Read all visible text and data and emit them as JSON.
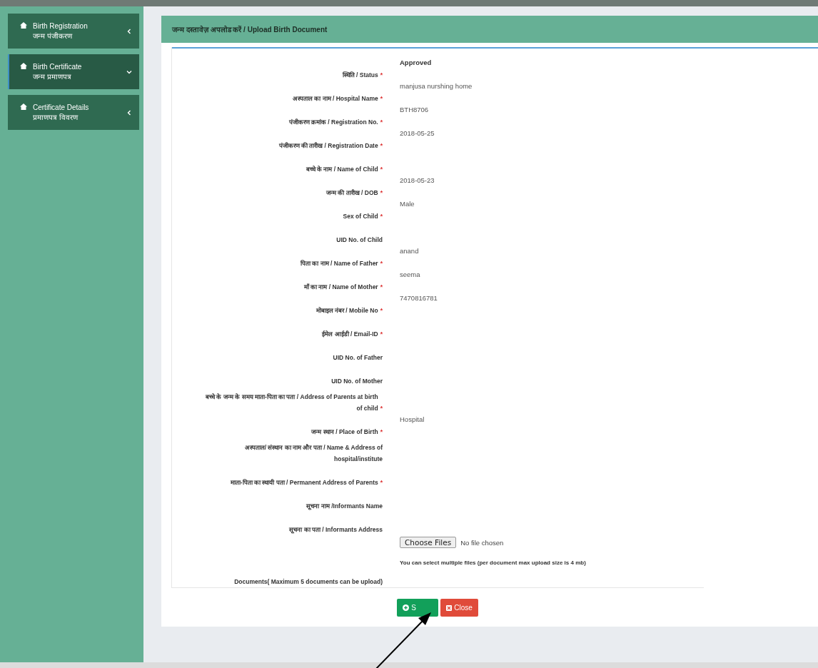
{
  "sidebar": {
    "items": [
      {
        "title": "Birth Registration",
        "subtitle": "जन्म पंजीकरण",
        "expanded": false,
        "selected": false
      },
      {
        "title": "Birth Certificate",
        "subtitle": "जन्म प्रमाणपत्र",
        "expanded": true,
        "selected": true
      },
      {
        "title": "Certificate Details",
        "subtitle": "प्रमाणपत्र विवरण",
        "expanded": false,
        "selected": false
      }
    ]
  },
  "panel": {
    "title": "जन्म दस्तावेज़ अपलोड करें / Upload Birth Document",
    "fields": [
      {
        "kind": "text",
        "label": "स्थिति / Status",
        "marker": "*",
        "value": "Approved",
        "bold": true
      },
      {
        "kind": "text",
        "label": "अस्पताल का नाम / Hospital Name",
        "marker": "*",
        "value": "manjusa nurshing home"
      },
      {
        "kind": "text",
        "label": "पंजीकरण क्रमांक / Registration No.",
        "marker": "*",
        "value": "BTH8706"
      },
      {
        "kind": "text",
        "label": "पंजीकरण की तारीख / Registration Date",
        "marker": "*",
        "value": "2018-05-25"
      },
      {
        "kind": "text",
        "label": "बच्चे के नाम / Name of Child",
        "marker": "*"
      },
      {
        "kind": "text",
        "label": "जन्म की तारीख / DOB",
        "marker": "*",
        "value": "2018-05-23"
      },
      {
        "kind": "text",
        "label": "Sex of Child",
        "marker": "*",
        "value": "Male"
      },
      {
        "kind": "text",
        "label": "UID No. of Child"
      },
      {
        "kind": "text",
        "label": "पिता का नाम / Name of Father",
        "marker": "*",
        "value": "anand"
      },
      {
        "kind": "text",
        "label": "माँ का नाम / Name of Mother",
        "marker": "*",
        "value": "seema"
      },
      {
        "kind": "text",
        "label": "मोबाइल नंबर / Mobile No",
        "marker": "*",
        "value": "7470816781"
      },
      {
        "kind": "text",
        "label": "ईमेल आईडी / Email-ID",
        "marker": "*"
      },
      {
        "kind": "text",
        "label": "UID No. of Father"
      },
      {
        "kind": "text",
        "label": "UID No. of Mother"
      },
      {
        "kind": "text",
        "label": "बच्चे के जन्म के समय माता-पिता का पता / Address of Parents at birth of child",
        "marker": "*"
      },
      {
        "kind": "text",
        "label": "जन्म स्थान / Place of Birth",
        "marker": "*",
        "value": "Hospital"
      },
      {
        "kind": "text",
        "label": "अस्पताल/ संस्थान का नाम और पता / Name & Address of hospital/institute"
      },
      {
        "kind": "text",
        "label": "माता-पिता का स्थायी पता / Permanent Address of Parents",
        "marker": "*"
      },
      {
        "kind": "text",
        "label": "सूचना नाम /Informants Name"
      },
      {
        "kind": "text",
        "label": "सूचना का पता / Informants Address"
      },
      {
        "kind": "file",
        "label": "Documents( Maximum 5 documents can be upload)",
        "button": "Choose Files",
        "status": "No file chosen",
        "help": "You can select multiple files (per document max upload size is 4 mb)"
      }
    ],
    "buttons": [
      {
        "kind": "save",
        "label": "S"
      },
      {
        "kind": "close",
        "label": "Close"
      }
    ]
  }
}
